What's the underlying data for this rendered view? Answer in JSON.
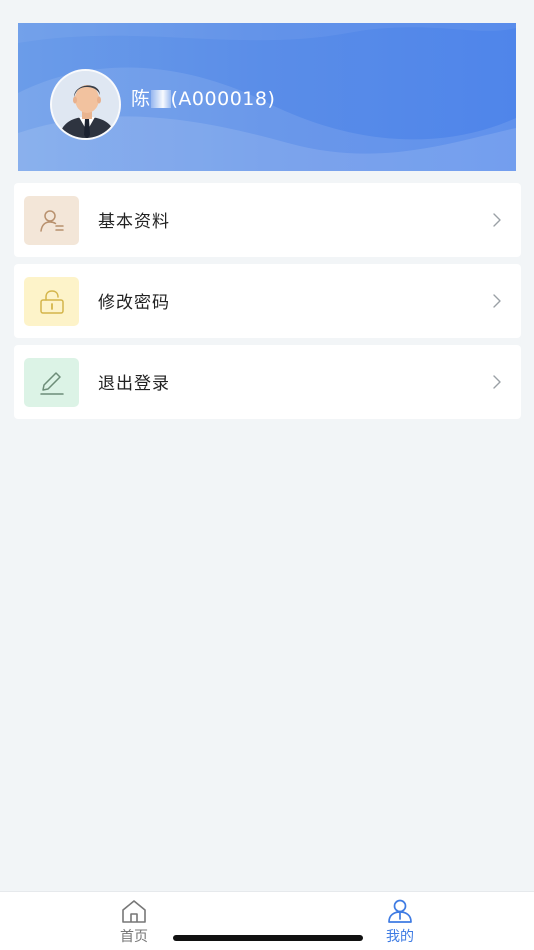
{
  "profile": {
    "name": "陈",
    "code": "(A000018)"
  },
  "menu": [
    {
      "label": "基本资料",
      "icon": "user-profile-icon",
      "bg": "#f3e6d8",
      "stroke": "#b8916e"
    },
    {
      "label": "修改密码",
      "icon": "lock-icon",
      "bg": "#fdf3c9",
      "stroke": "#d4b54a"
    },
    {
      "label": "退出登录",
      "icon": "pencil-icon",
      "bg": "#dcf3e6",
      "stroke": "#6d8d78"
    }
  ],
  "tabbar": {
    "items": [
      {
        "label": "首页",
        "icon": "home-icon",
        "active": false
      },
      {
        "label": "我的",
        "icon": "person-icon",
        "active": true
      }
    ],
    "active_color": "#3e7be3",
    "inactive_color": "#777777"
  },
  "colors": {
    "banner": "#5a8de8",
    "background": "#f2f5f7"
  }
}
